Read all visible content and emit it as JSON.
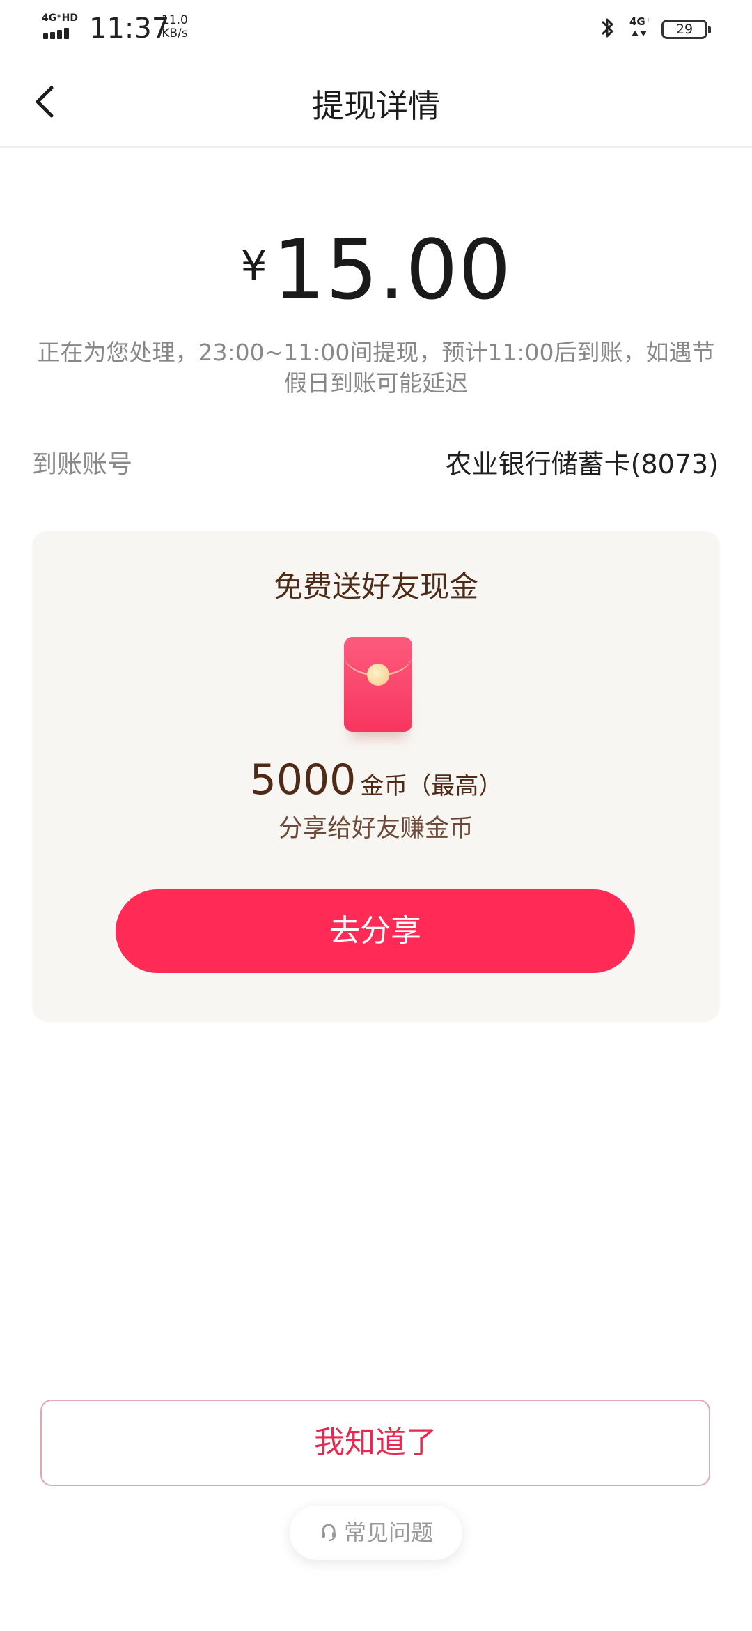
{
  "status_bar": {
    "network": "4G⁺HD",
    "time": "11:37",
    "speed_value": "11.0",
    "speed_unit": "KB/s",
    "network2": "4G⁺",
    "battery": "29"
  },
  "header": {
    "title": "提现详情"
  },
  "withdrawal": {
    "currency": "¥",
    "amount": "15.00",
    "notice": "正在为您处理，23:00~11:00间提现，预计11:00后到账，如遇节假日到账可能延迟",
    "account_label": "到账账号",
    "account_value": "农业银行储蓄卡(8073)"
  },
  "promo": {
    "title": "免费送好友现金",
    "coins_amount": "5000",
    "coins_unit": "金币（最高）",
    "subtitle": "分享给好友赚金币",
    "share_label": "去分享"
  },
  "footer": {
    "ok_label": "我知道了",
    "faq_label": "常见问题"
  },
  "colors": {
    "accent": "#ff2b56",
    "card_bg": "#f8f6f2",
    "promo_text": "#4e2a17"
  }
}
